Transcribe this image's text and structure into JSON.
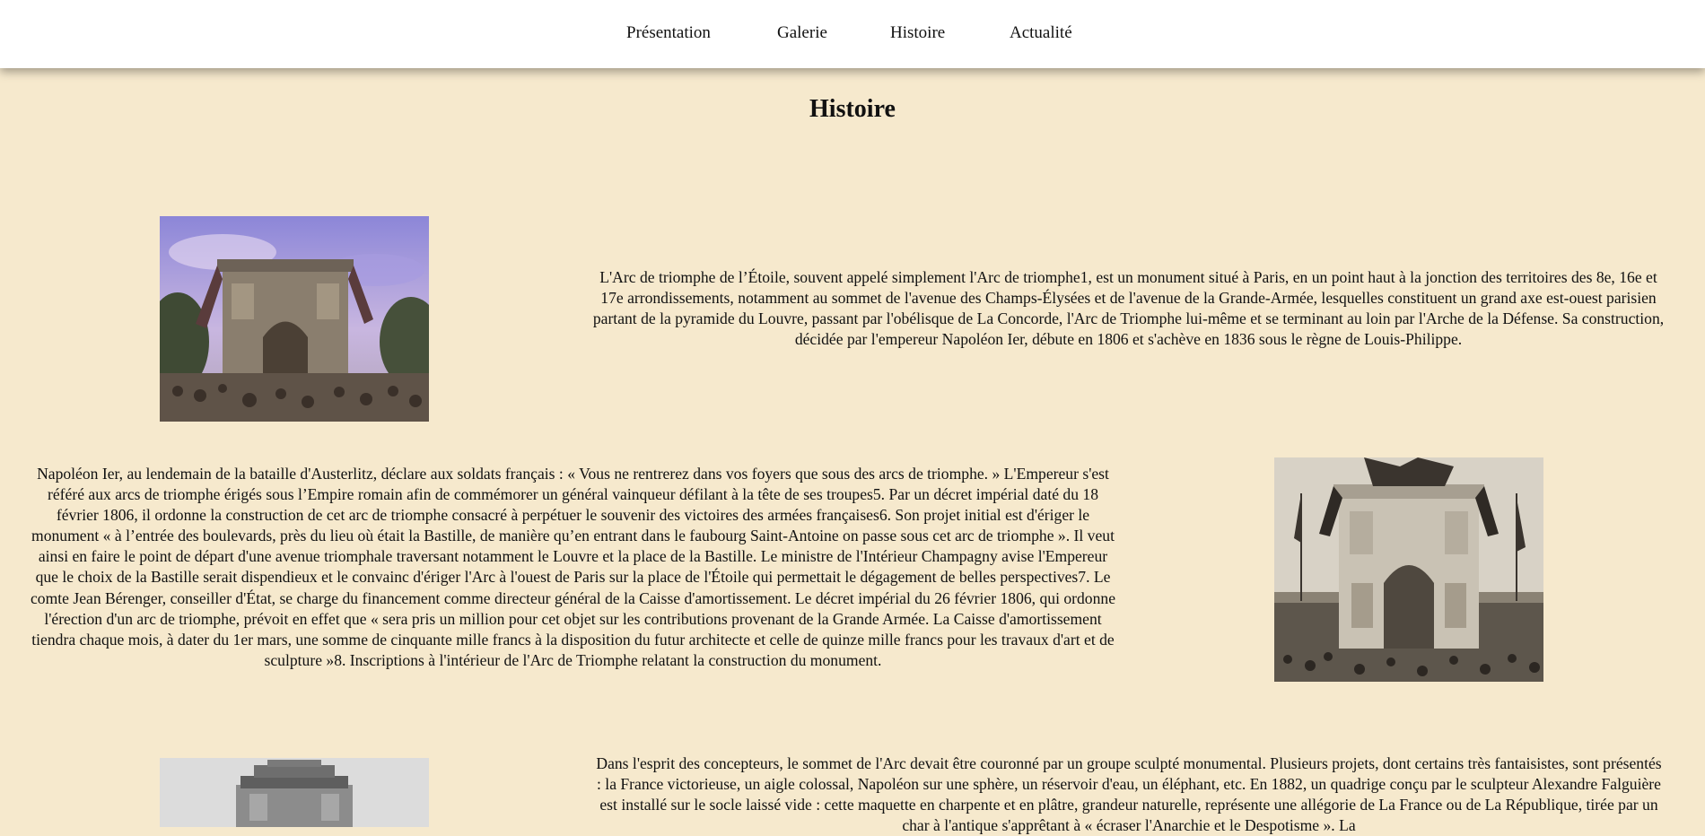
{
  "nav": {
    "items": [
      {
        "label": "Présentation"
      },
      {
        "label": "Galerie"
      },
      {
        "label": "Histoire"
      },
      {
        "label": "Actualité"
      }
    ]
  },
  "page": {
    "title": "Histoire"
  },
  "sections": [
    {
      "text": "L'Arc de triomphe de l’Étoile, souvent appelé simplement l'Arc de triomphe1, est un monument situé à Paris, en un point haut à la jonction des territoires des 8e, 16e et 17e arrondissements, notamment au sommet de l'avenue des Champs-Élysées et de l'avenue de la Grande-Armée, lesquelles constituent un grand axe est-ouest parisien partant de la pyramide du Louvre, passant par l'obélisque de La Concorde, l'Arc de Triomphe lui-même et se terminant au loin par l'Arche de la Défense. Sa construction, décidée par l'empereur Napoléon Ier, débute en 1806 et s'achève en 1836 sous le règne de Louis-Philippe.",
      "image": "arc-painting-color"
    },
    {
      "text": "Napoléon Ier, au lendemain de la bataille d'Austerlitz, déclare aux soldats français : « Vous ne rentrerez dans vos foyers que sous des arcs de triomphe. » L'Empereur s'est référé aux arcs de triomphe érigés sous l’Empire romain afin de commémorer un général vainqueur défilant à la tête de ses troupes5. Par un décret impérial daté du 18 février 1806, il ordonne la construction de cet arc de triomphe consacré à perpétuer le souvenir des victoires des armées françaises6. Son projet initial est d'ériger le monument « à l’entrée des boulevards, près du lieu où était la Bastille, de manière qu’en entrant dans le faubourg Saint-Antoine on passe sous cet arc de triomphe ». Il veut ainsi en faire le point de départ d'une avenue triomphale traversant notamment le Louvre et la place de la Bastille. Le ministre de l'Intérieur Champagny avise l'Empereur que le choix de la Bastille serait dispendieux et le convainc d'ériger l'Arc à l'ouest de Paris sur la place de l'Étoile qui permettait le dégagement de belles perspectives7. Le comte Jean Bérenger, conseiller d'État, se charge du financement comme directeur général de la Caisse d'amortissement. Le décret impérial du 26 février 1806, qui ordonne l'érection d'un arc de triomphe, prévoit en effet que « sera pris un million pour cet objet sur les contributions provenant de la Grande Armée. La Caisse d'amortissement tiendra chaque mois, à dater du 1er mars, une somme de cinquante mille francs à la disposition du futur architecte et celle de quinze mille francs pour les travaux d'art et de sculpture »8. Inscriptions à l'intérieur de l'Arc de Triomphe relatant la construction du monument.",
      "image": "arc-photo-sepia"
    },
    {
      "text": "Dans l'esprit des concepteurs, le sommet de l'Arc devait être couronné par un groupe sculpté monumental. Plusieurs projets, dont certains très fantaisistes, sont présentés : la France victorieuse, un aigle colossal, Napoléon sur une sphère, un réservoir d'eau, un éléphant, etc. En 1882, un quadrige conçu par le sculpteur Alexandre Falguière est installé sur le socle laissé vide : cette maquette en charpente et en plâtre, grandeur naturelle, représente une allégorie de La France ou de La République, tirée par un char à l'antique s'apprêtant à « écraser l'Anarchie et le Despotisme ». La",
      "image": "arc-photo-bw"
    }
  ]
}
